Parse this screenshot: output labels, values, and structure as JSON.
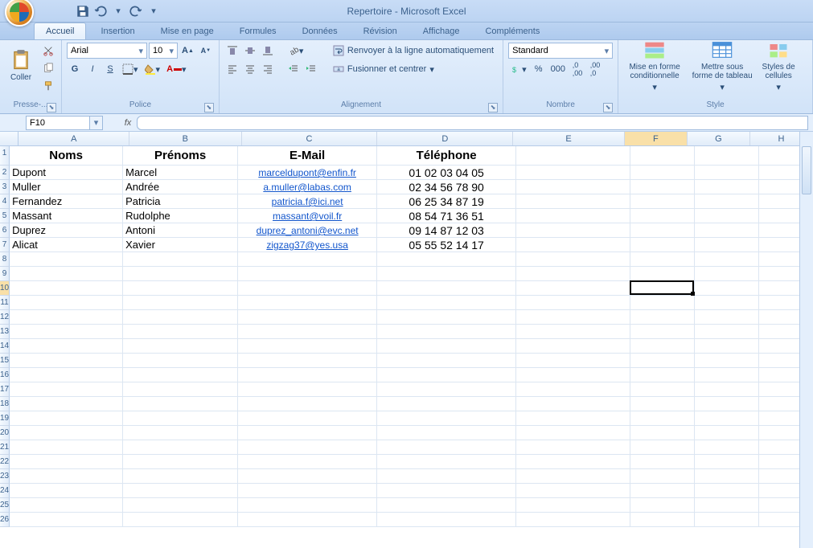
{
  "app": {
    "title": "Repertoire - Microsoft Excel"
  },
  "qat": {
    "save": "save-icon",
    "undo": "undo-icon",
    "redo": "redo-icon"
  },
  "tabs": [
    "Accueil",
    "Insertion",
    "Mise en page",
    "Formules",
    "Données",
    "Révision",
    "Affichage",
    "Compléments"
  ],
  "active_tab": 0,
  "ribbon": {
    "clipboard": {
      "paste": "Coller",
      "label": "Presse-..."
    },
    "font": {
      "name": "Arial",
      "size": "10",
      "bold": "G",
      "italic": "I",
      "underline": "S",
      "label": "Police",
      "grow": "A",
      "shrink": "A"
    },
    "alignment": {
      "wrap": "Renvoyer à la ligne automatiquement",
      "merge": "Fusionner et centrer",
      "label": "Alignement"
    },
    "number": {
      "format": "Standard",
      "label": "Nombre"
    },
    "style": {
      "cond": "Mise en forme conditionnelle",
      "table": "Mettre sous forme de tableau",
      "cells": "Styles de cellules",
      "label": "Style"
    }
  },
  "namebox": "F10",
  "formula": "",
  "columns": [
    "A",
    "B",
    "C",
    "D",
    "E",
    "F",
    "G",
    "H"
  ],
  "col_widths": {
    "A": 141,
    "B": 143,
    "C": 173,
    "D": 173,
    "E": 142,
    "F": 80,
    "G": 80,
    "H": 80
  },
  "headers": {
    "A": "Noms",
    "B": "Prénoms",
    "C": "E-Mail",
    "D": "Téléphone"
  },
  "rows": [
    {
      "nom": "Dupont",
      "prenom": "Marcel",
      "email": "marceldupont@enfin.fr",
      "tel": "01 02 03 04 05"
    },
    {
      "nom": "Muller",
      "prenom": "Andrée",
      "email": "a.muller@labas.com",
      "tel": "02 34 56 78 90"
    },
    {
      "nom": "Fernandez",
      "prenom": "Patricia",
      "email": "patricia.f@ici.net",
      "tel": "06 25 34 87 19"
    },
    {
      "nom": "Massant",
      "prenom": "Rudolphe",
      "email": "massant@voil.fr",
      "tel": "08 54 71 36 51"
    },
    {
      "nom": "Duprez",
      "prenom": "Antoni",
      "email": "duprez_antoni@evc.net",
      "tel": "09 14 87 12 03"
    },
    {
      "nom": "Alicat",
      "prenom": "Xavier",
      "email": "zigzag37@yes.usa",
      "tel": "05 55 52 14 17"
    }
  ],
  "total_rows": 26,
  "selection": {
    "col": "F",
    "row": 10
  }
}
